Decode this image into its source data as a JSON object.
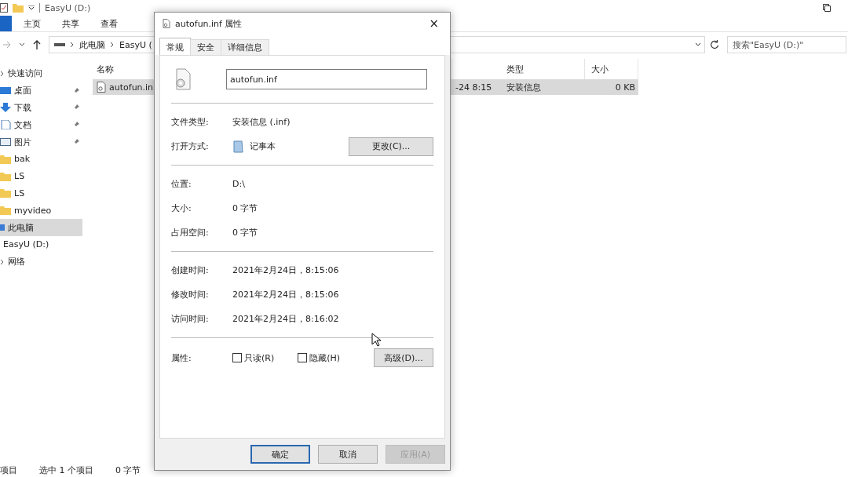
{
  "explorer": {
    "title": "EasyU (D:)",
    "ribbon_tabs": [
      "主页",
      "共享",
      "查看"
    ],
    "breadcrumb": [
      "此电脑",
      "EasyU ("
    ],
    "search": {
      "placeholder": "搜索\"EasyU (D:)\""
    },
    "sidebar": [
      {
        "label": "快速访问",
        "kind": "star",
        "selected": false,
        "children": [
          {
            "label": "桌面",
            "kind": "desktop",
            "pinned": true,
            "selected": false
          },
          {
            "label": "下载",
            "kind": "download",
            "pinned": true,
            "selected": false
          },
          {
            "label": "文档",
            "kind": "document",
            "pinned": true,
            "selected": false
          },
          {
            "label": "图片",
            "kind": "pictures",
            "pinned": true,
            "selected": false
          },
          {
            "label": "bak",
            "kind": "folder",
            "pinned": false,
            "selected": false
          },
          {
            "label": "LS",
            "kind": "folder",
            "pinned": false,
            "selected": false
          },
          {
            "label": "LS",
            "kind": "folder",
            "pinned": false,
            "selected": false
          },
          {
            "label": "myvideo",
            "kind": "folder",
            "pinned": false,
            "selected": false
          }
        ]
      },
      {
        "label": "此电脑",
        "kind": "pc",
        "selected": true
      },
      {
        "label": "EasyU (D:)",
        "kind": "drive",
        "selected": false
      },
      {
        "label": "网络",
        "kind": "network",
        "selected": false
      }
    ],
    "columns": {
      "name": "名称",
      "type": "类型",
      "size": "大小"
    },
    "files": [
      {
        "name": "autofun.in",
        "date": "-24 8:15",
        "type": "安装信息",
        "size": "0 KB",
        "selected": true
      }
    ],
    "status_bar": [
      "项目",
      "选中 1 个项目",
      "0 字节"
    ]
  },
  "dialog": {
    "title": "autofun.inf 属性",
    "close": "×",
    "tabs": [
      {
        "label": "常规",
        "selected": true
      },
      {
        "label": "安全",
        "selected": false
      },
      {
        "label": "详细信息",
        "selected": false
      }
    ],
    "file_name": "autofun.inf",
    "sections": [
      [
        {
          "label": "文件类型:",
          "value": "安装信息 (.inf)"
        },
        {
          "label": "打开方式:",
          "value": "记事本",
          "kind": "app",
          "button": "更改(C)..."
        }
      ],
      [
        {
          "label": "位置:",
          "value": "D:\\"
        },
        {
          "label": "大小:",
          "value": "0 字节"
        },
        {
          "label": "占用空间:",
          "value": "0 字节"
        }
      ],
      [
        {
          "label": "创建时间:",
          "value": "2021年2月24日，8:15:06"
        },
        {
          "label": "修改时间:",
          "value": "2021年2月24日，8:15:06"
        },
        {
          "label": "访问时间:",
          "value": "2021年2月24日，8:16:02"
        }
      ]
    ],
    "attributes": {
      "label": "属性:",
      "checkboxes": [
        {
          "label": "只读(R)",
          "checked": false
        },
        {
          "label": "隐藏(H)",
          "checked": false
        }
      ],
      "button": "高级(D)..."
    },
    "buttons": [
      {
        "label": "确定",
        "default": true,
        "disabled": false
      },
      {
        "label": "取消",
        "default": false,
        "disabled": false
      },
      {
        "label": "应用(A)",
        "default": false,
        "disabled": true
      }
    ]
  }
}
